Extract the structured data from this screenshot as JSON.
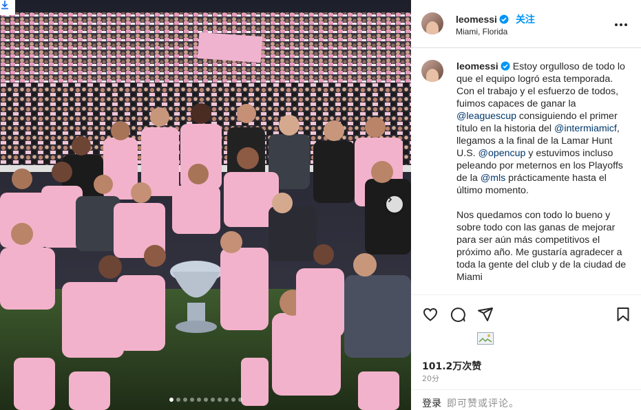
{
  "post": {
    "username": "leomessi",
    "follow_label": "关注",
    "location": "Miami, Florida",
    "caption_p1_before": "Estoy orgulloso de todo lo que el equipo logró esta temporada. Con el trabajo y el esfuerzo de todos, fuimos capaces de ganar la ",
    "m1": "@leaguescup",
    "caption_p1_mid1": " consiguiendo el primer título en la historia del ",
    "m2": "@intermiamicf",
    "caption_p1_mid2": ", llegamos a la final de la Lamar Hunt U.S. ",
    "m3": "@opencup",
    "caption_p1_mid3": " y estuvimos incluso peleando por meternos en los Playoffs de la ",
    "m4": "@mls",
    "caption_p1_after": " prácticamente hasta el último momento.",
    "caption_p2": "Nos quedamos con todo lo bueno y sobre todo con las ganas de mejorar para ser aún más competitivos el próximo año. Me gustaría agradecer a toda la gente del club y de la ciudad de Miami",
    "likes": "101.2万次赞",
    "time_ago": "20分",
    "login_label": "登录",
    "login_rest": "即可赞或评论。"
  },
  "carousel": {
    "slide_count": 11,
    "active_index": 0
  },
  "colors": {
    "accent": "#0095f6",
    "mention": "#00376b",
    "jersey_pink": "#f4b6cc"
  },
  "icons": [
    "download-icon",
    "verified-icon",
    "more-options-icon",
    "like-icon",
    "comment-icon",
    "share-icon",
    "save-icon",
    "next-arrow-icon"
  ]
}
